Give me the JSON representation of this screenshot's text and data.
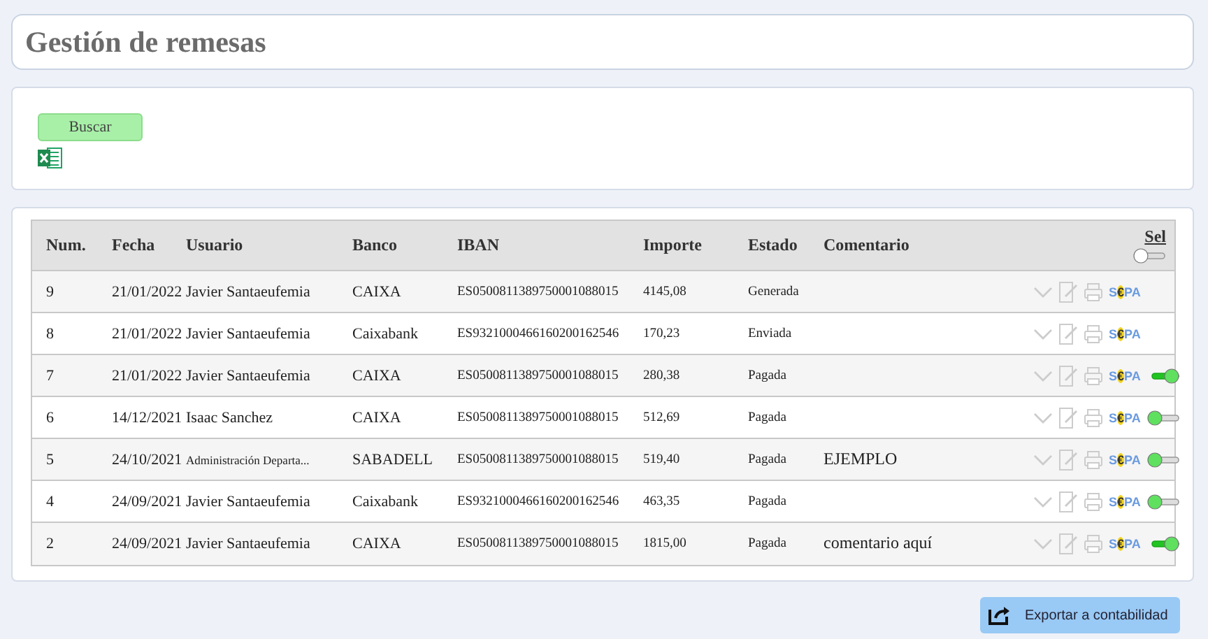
{
  "page_title": "Gestión de remesas",
  "search": {
    "button": "Buscar"
  },
  "table": {
    "columns": [
      "Num.",
      "Fecha",
      "Usuario",
      "Banco",
      "IBAN",
      "Importe",
      "Estado",
      "Comentario"
    ],
    "select_header": {
      "label": "Sel",
      "on": false
    },
    "rows": [
      {
        "num": "9",
        "fecha": "21/01/2022",
        "usuario": "Javier Santaeufemia",
        "banco": "CAIXA",
        "iban": "ES0500811389750001088015",
        "importe": "4145,08",
        "estado": "Generada",
        "comentario": "",
        "sepa": "S€PA"
      },
      {
        "num": "8",
        "fecha": "21/01/2022",
        "usuario": "Javier Santaeufemia",
        "banco": "Caixabank",
        "iban": "ES9321000466160200162546",
        "importe": "170,23",
        "estado": "Enviada",
        "comentario": "",
        "sepa": "S€PA"
      },
      {
        "num": "7",
        "fecha": "21/01/2022",
        "usuario": "Javier Santaeufemia",
        "banco": "CAIXA",
        "iban": "ES0500811389750001088015",
        "importe": "280,38",
        "estado": "Pagada",
        "comentario": "",
        "switch": {
          "on": true
        },
        "sepa": "S€PA"
      },
      {
        "num": "6",
        "fecha": "14/12/2021",
        "usuario": "Isaac Sanchez",
        "banco": "CAIXA",
        "iban": "ES0500811389750001088015",
        "importe": "512,69",
        "estado": "Pagada",
        "comentario": "",
        "switch": {
          "on": false
        },
        "sepa": "S€PA"
      },
      {
        "num": "5",
        "fecha": "24/10/2021",
        "usuario": "Administración Departa...",
        "usuario_small": true,
        "banco": "SABADELL",
        "iban": "ES0500811389750001088015",
        "importe": "519,40",
        "estado": "Pagada",
        "comentario": "EJEMPLO",
        "switch": {
          "on": false
        },
        "sepa": "S€PA"
      },
      {
        "num": "4",
        "fecha": "24/09/2021",
        "usuario": "Javier Santaeufemia",
        "banco": "Caixabank",
        "iban": "ES9321000466160200162546",
        "importe": "463,35",
        "estado": "Pagada",
        "comentario": "",
        "switch": {
          "on": false
        },
        "sepa": "S€PA"
      },
      {
        "num": "2",
        "fecha": "24/09/2021",
        "usuario": "Javier Santaeufemia",
        "banco": "CAIXA",
        "iban": "ES0500811389750001088015",
        "importe": "1815,00",
        "estado": "Pagada",
        "comentario": "comentario aquí",
        "switch": {
          "on": true
        },
        "sepa": "S€PA"
      }
    ]
  },
  "export_button": "Exportar a contabilidad"
}
